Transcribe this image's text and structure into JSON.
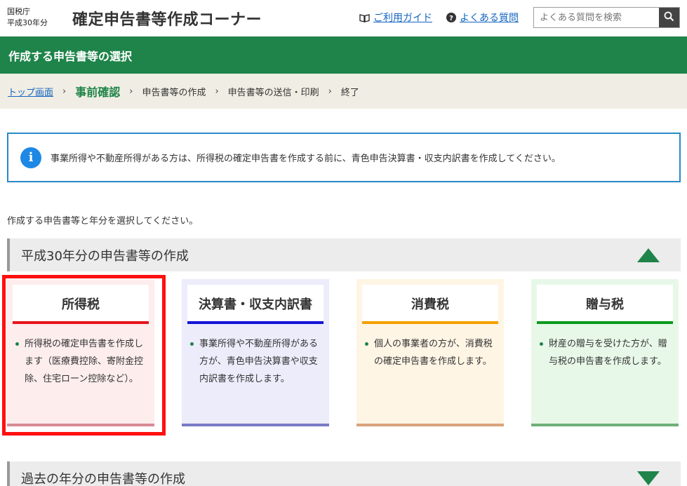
{
  "header": {
    "agency_line1": "国税庁",
    "agency_line2": "平成30年分",
    "site_title": "確定申告書等作成コーナー",
    "guide_link": "ご利用ガイド",
    "faq_link": "よくある質問",
    "search_placeholder": "よくある質問を検索"
  },
  "page_title": "作成する申告書等の選択",
  "breadcrumb": {
    "items": [
      "トップ画面",
      "事前確認",
      "申告書等の作成",
      "申告書等の送信・印刷",
      "終了"
    ],
    "current_index": 1
  },
  "info_message": "事業所得や不動産所得がある方は、所得税の確定申告書を作成する前に、青色申告決算書・収支内訳書を作成してください。",
  "instruction": "作成する申告書等と年分を選択してください。",
  "sections": [
    {
      "label": "平成30年分の申告書等の作成",
      "expanded": true
    },
    {
      "label": "過去の年分の申告書等の作成",
      "expanded": false
    }
  ],
  "cards": [
    {
      "title": "所得税",
      "desc": "所得税の確定申告書を作成します（医療費控除、寄附金控除、住宅ローン控除など）。",
      "selected": true
    },
    {
      "title": "決算書・収支内訳書",
      "desc": "事業所得や不動産所得がある方が、青色申告決算書や収支内訳書を作成します。"
    },
    {
      "title": "消費税",
      "desc": "個人の事業者の方が、消費税の確定申告書を作成します。"
    },
    {
      "title": "贈与税",
      "desc": "財産の贈与を受けた方が、贈与税の申告書を作成します。"
    }
  ],
  "colors": {
    "brand_green": "#1e8449",
    "link_blue": "#1565c0",
    "info_border": "#2a88c8",
    "highlight_red": "#ff1010"
  },
  "icons": {
    "guide": "book-icon",
    "faq": "question-circle-icon",
    "search": "magnifier-icon",
    "info": "info-circle-icon",
    "expand": "triangle-up-icon",
    "collapse": "triangle-down-icon"
  }
}
